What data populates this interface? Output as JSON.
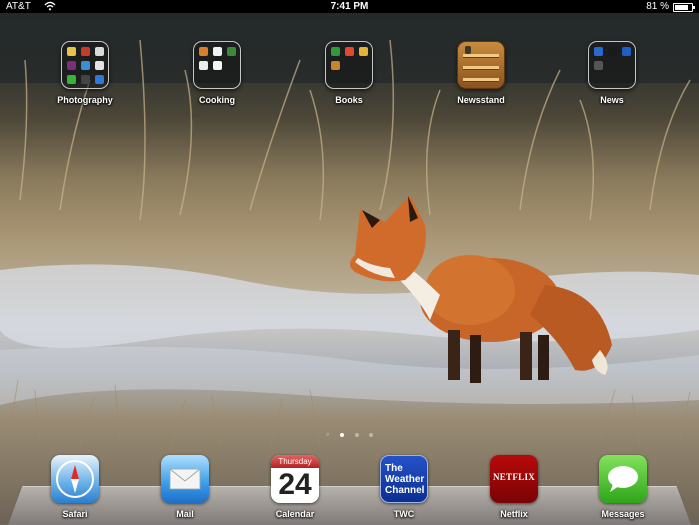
{
  "status_bar": {
    "carrier": "AT&T",
    "time": "7:41 PM",
    "battery_percent": "81 %",
    "battery_level": 0.81
  },
  "home_icons": [
    {
      "label": "Photography",
      "type": "folder"
    },
    {
      "label": "Cooking",
      "type": "folder"
    },
    {
      "label": "Books",
      "type": "folder"
    },
    {
      "label": "Newsstand",
      "type": "app"
    },
    {
      "label": "News",
      "type": "folder"
    }
  ],
  "page_indicator": {
    "pages": 3,
    "current": 1
  },
  "dock": [
    {
      "label": "Safari",
      "icon": "safari-icon"
    },
    {
      "label": "Mail",
      "icon": "mail-icon"
    },
    {
      "label": "Calendar",
      "icon": "calendar-icon",
      "weekday": "Thursday",
      "day": "24"
    },
    {
      "label": "TWC",
      "icon": "weather-channel-icon",
      "icon_text": "The Weather Channel"
    },
    {
      "label": "Netflix",
      "icon": "netflix-icon",
      "icon_text": "NETFLIX"
    },
    {
      "label": "Messages",
      "icon": "messages-icon"
    }
  ],
  "colors": {
    "status_bar": "#000000",
    "label_text": "#ffffff",
    "fox": "#c8662a"
  }
}
